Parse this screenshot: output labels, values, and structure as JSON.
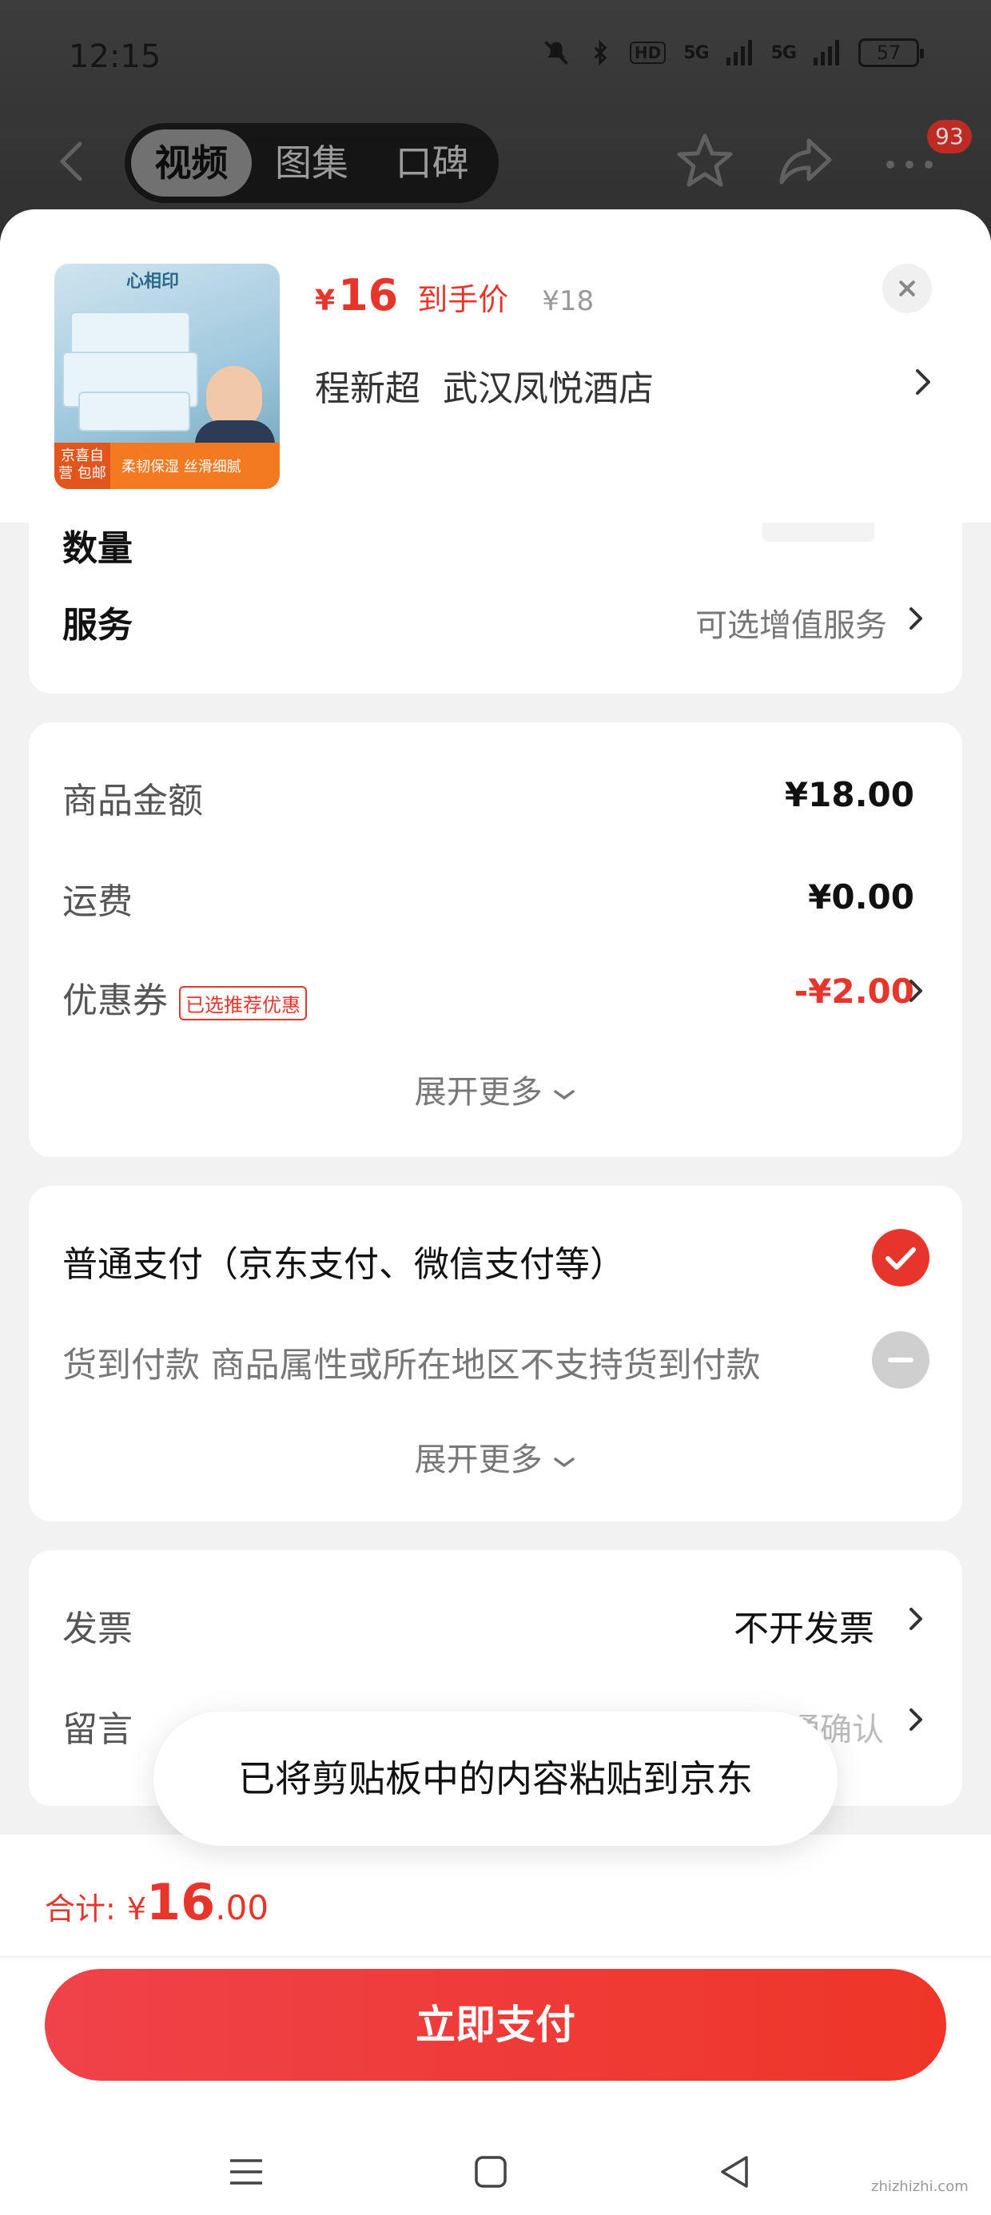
{
  "status_bar": {
    "time": "12:15",
    "signal1": "5G",
    "signal2": "5G",
    "hd": "HD",
    "battery": "57"
  },
  "nav": {
    "tabs": [
      "视频",
      "图集",
      "口碑"
    ],
    "active_tab": "视频",
    "notification_count": "93"
  },
  "product": {
    "price_symbol": "¥",
    "price": "16",
    "price_label": "到手价",
    "original_price": "¥18",
    "receiver_name": "程新超",
    "receiver_address": "武汉凤悦酒店",
    "thumb_brand": "心相印",
    "thumb_strip_left": "京喜自营 包邮",
    "thumb_strip_text": "柔韧保湿  丝滑细腻"
  },
  "service": {
    "label": "服务",
    "value": "可选增值服务"
  },
  "quantity_label": "数量",
  "amounts": {
    "goods_label": "商品金额",
    "goods_value": "¥18.00",
    "shipping_label": "运费",
    "shipping_value": "¥0.00",
    "coupon_label": "优惠券",
    "coupon_tag": "已选推荐优惠",
    "coupon_value": "-¥2.00",
    "expand": "展开更多"
  },
  "payment": {
    "option1": "普通支付（京东支付、微信支付等）",
    "option2": "货到付款 商品属性或所在地区不支持货到付款",
    "expand": "展开更多"
  },
  "invoice": {
    "label": "发票",
    "value": "不开发票"
  },
  "message": {
    "label": "留言",
    "placeholder": "建议留言前先与商家沟通确认"
  },
  "toast": "已将剪贴板中的内容粘贴到京东",
  "total": {
    "label": "合计:",
    "symbol": "¥",
    "integer": "16",
    "decimal": ".00"
  },
  "pay_button": "立即支付",
  "watermark": "zhizhizhi.com",
  "colors": {
    "accent": "#e8352c",
    "background": "#f2f2f2"
  }
}
